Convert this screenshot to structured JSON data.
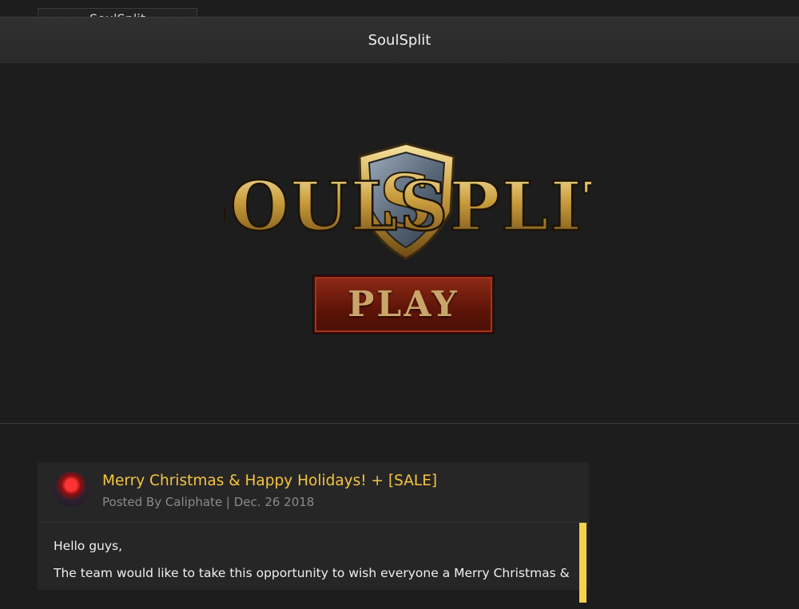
{
  "browser": {
    "tab_title": "SoulSplit"
  },
  "header": {
    "title": "SoulSplit"
  },
  "hero": {
    "logo_text": "SOULSPLIT",
    "play_label": "PLAY"
  },
  "post": {
    "title": "Merry Christmas & Happy Holidays! + [SALE]",
    "meta": "Posted By Caliphate | Dec. 26 2018",
    "greeting": "Hello guys,",
    "body_line": "The team would like to take this opportunity to wish everyone a Merry Christmas &"
  },
  "colors": {
    "accent": "#f5c542",
    "bar": "#f5d24b",
    "play_red": "#7a1e0e"
  }
}
